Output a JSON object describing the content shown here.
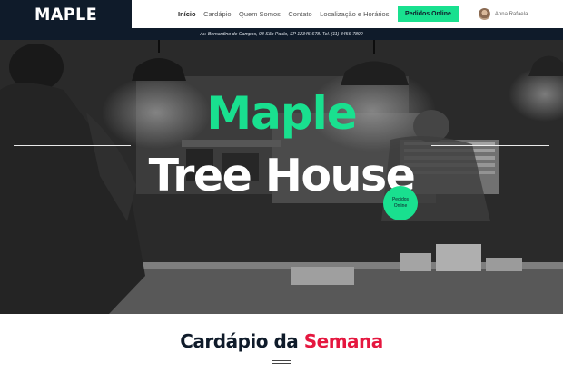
{
  "brand": {
    "logo": "MAPLE"
  },
  "nav": {
    "links": [
      "Início",
      "Cardápio",
      "Quem Somos",
      "Contato",
      "Localização e Horários"
    ],
    "order_button": "Pedidos Online"
  },
  "user": {
    "name": "Anna Rafaela"
  },
  "address": "Av. Bernardino de Campos, 98 São Paulo, SP 12345-678. Tel. (11) 3456-7890",
  "hero": {
    "title_line1": "Maple",
    "title_line2": "Tree House",
    "circle_button_line1": "Pedidos",
    "circle_button_line2": "Online"
  },
  "menu": {
    "heading_part1": "Cardápio da ",
    "heading_part2": "Semana"
  },
  "colors": {
    "navy": "#0f1b2a",
    "accent_green": "#19e08f",
    "accent_red": "#e5173f"
  },
  "icons": {
    "avatar": "user-avatar"
  }
}
